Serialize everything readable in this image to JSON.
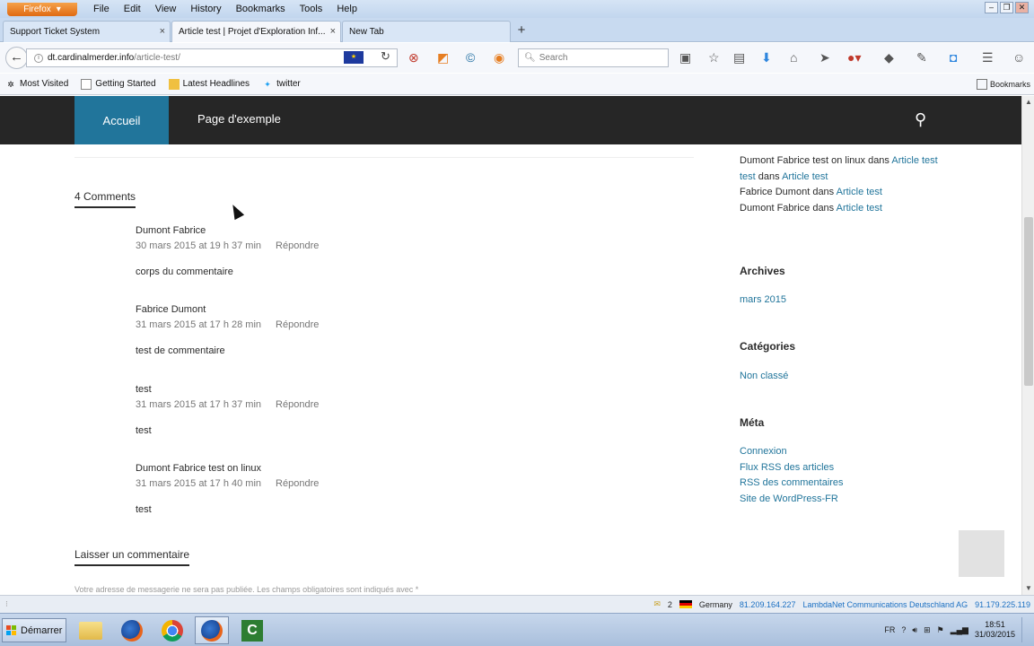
{
  "browser": {
    "app_button": "Firefox",
    "menu": [
      "File",
      "Edit",
      "View",
      "History",
      "Bookmarks",
      "Tools",
      "Help"
    ],
    "tabs": [
      {
        "label": "Support Ticket System"
      },
      {
        "label": "Article test | Projet d'Exploration Inf..."
      },
      {
        "label": "New Tab"
      }
    ],
    "url": {
      "domain": "dt.cardinalmerder.info",
      "path": "/article-test/"
    },
    "search_placeholder": "Search",
    "bookmarks": [
      "Most Visited",
      "Getting Started",
      "Latest Headlines",
      "twitter"
    ],
    "bookmarks_menu": "Bookmarks"
  },
  "site": {
    "nav": {
      "home": "Accueil",
      "sample_page": "Page d'exemple"
    },
    "comments_title": "4 Comments",
    "comments": [
      {
        "author": "Dumont Fabrice",
        "date": "30 mars 2015 at 19 h 37 min",
        "reply": "Répondre",
        "body": "corps du commentaire"
      },
      {
        "author": "Fabrice Dumont",
        "date": "31 mars 2015 at 17 h 28 min",
        "reply": "Répondre",
        "body": "test de commentaire"
      },
      {
        "author": "test",
        "date": "31 mars 2015 at 17 h 37 min",
        "reply": "Répondre",
        "body": "test"
      },
      {
        "author": "Dumont Fabrice test on linux",
        "date": "31 mars 2015 at 17 h 40 min",
        "reply": "Répondre",
        "body": "test"
      }
    ],
    "leave_comment_title": "Laisser un commentaire",
    "leave_comment_note": "Votre adresse de messagerie ne sera pas publiée. Les champs obligatoires sont indiqués avec *",
    "sidebar": {
      "recent_comments": [
        {
          "author": "Dumont Fabrice test on linux",
          "sep": " dans ",
          "post": "Article test"
        },
        {
          "author": "test",
          "sep": " dans ",
          "post": "Article test"
        },
        {
          "author": "Fabrice Dumont",
          "sep": " dans ",
          "post": "Article test"
        },
        {
          "author": "Dumont Fabrice",
          "sep": " dans ",
          "post": "Article test"
        }
      ],
      "archives_title": "Archives",
      "archives": [
        "mars 2015"
      ],
      "categories_title": "Catégories",
      "categories": [
        "Non classé"
      ],
      "meta_title": "Méta",
      "meta_links": [
        "Connexion",
        "Flux RSS des articles",
        "RSS des commentaires",
        "Site de WordPress-FR"
      ]
    }
  },
  "statusbar": {
    "count": "2",
    "country": "Germany",
    "ip1": "81.209.164.227",
    "isp": "LambdaNet Communications Deutschland AG",
    "ip2": "91.179.225.119"
  },
  "taskbar": {
    "start": "Démarrer",
    "lang": "FR",
    "time": "18:51",
    "date": "31/03/2015"
  },
  "colors": {
    "accent": "#21759b",
    "nav_bg": "#262626"
  }
}
